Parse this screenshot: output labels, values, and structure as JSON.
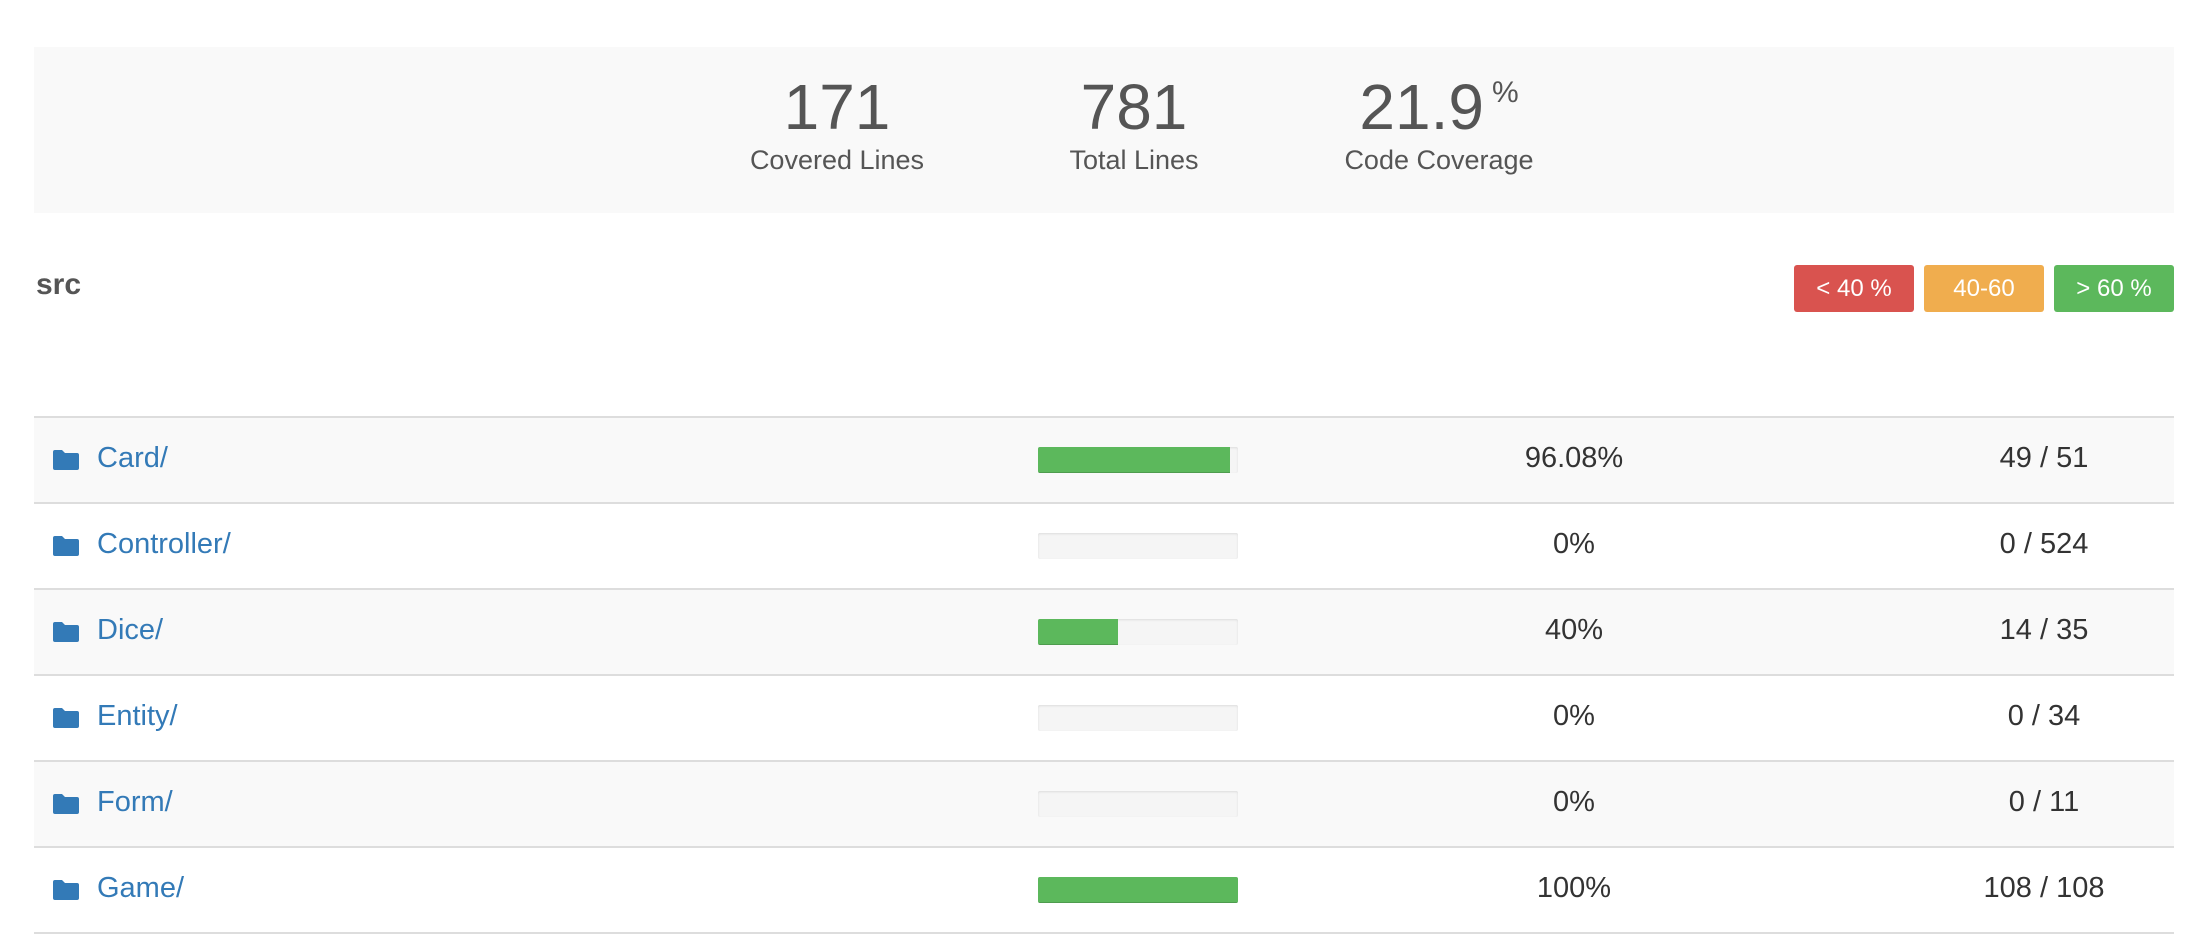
{
  "summary": {
    "covered_lines": "171",
    "covered_label": "Covered Lines",
    "total_lines": "781",
    "total_label": "Total Lines",
    "coverage": "21.9",
    "coverage_unit": "%",
    "coverage_label": "Code Coverage"
  },
  "directory": "src",
  "legend": {
    "low": "< 40 %",
    "mid": "40-60 %",
    "high": "> 60 %"
  },
  "colors": {
    "low": "#d9534f",
    "mid": "#f0ad4e",
    "high": "#5cb85c",
    "link": "#337ab7"
  },
  "rows": [
    {
      "name": "Card/",
      "percent": "96.08%",
      "fraction": "49 / 51",
      "coverage": 0.9608
    },
    {
      "name": "Controller/",
      "percent": "0%",
      "fraction": "0 / 524",
      "coverage": 0
    },
    {
      "name": "Dice/",
      "percent": "40%",
      "fraction": "14 / 35",
      "coverage": 0.4
    },
    {
      "name": "Entity/",
      "percent": "0%",
      "fraction": "0 / 34",
      "coverage": 0
    },
    {
      "name": "Form/",
      "percent": "0%",
      "fraction": "0 / 11",
      "coverage": 0
    },
    {
      "name": "Game/",
      "percent": "100%",
      "fraction": "108 / 108",
      "coverage": 1.0
    }
  ]
}
